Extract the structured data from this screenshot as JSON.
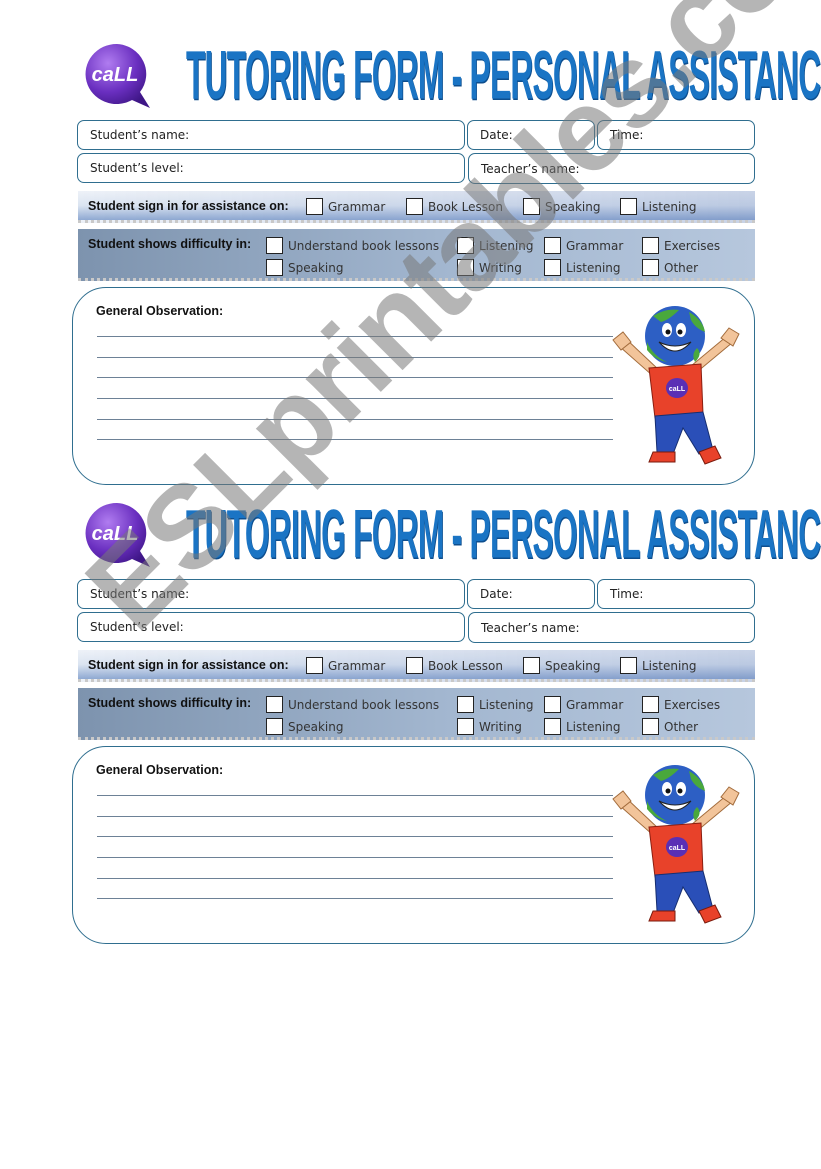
{
  "title": "TUTORING FORM - PERSONAL ASSISTANCE FILE",
  "logo_text": "caLL",
  "watermark": "ESLprintables.com",
  "colors": {
    "title": "#1a74c4",
    "logo": "#6a2fc0",
    "border": "#2f6e8f"
  },
  "forms": [
    {
      "fields": {
        "student_name": "Student’s name:",
        "date": "Date:",
        "time": "Time:",
        "student_level": "Student’s level:",
        "teacher_name": "Teacher’s name:"
      },
      "sign_in": {
        "label": "Student sign in for assistance on:",
        "options": [
          "Grammar",
          "Book Lesson",
          "Speaking",
          "Listening"
        ]
      },
      "difficulty": {
        "label": "Student shows difficulty in:",
        "options": [
          "Understand book lessons",
          "Listening",
          "Grammar",
          "Exercises",
          "Speaking",
          "Writing",
          "Listening",
          "Other"
        ]
      },
      "observation": {
        "label": "General Observation:",
        "line_count": 6
      }
    },
    {
      "fields": {
        "student_name": "Student’s name:",
        "date": "Date:",
        "time": "Time:",
        "student_level": "Student’s level:",
        "teacher_name": "Teacher’s name:"
      },
      "sign_in": {
        "label": "Student sign in for assistance on:",
        "options": [
          "Grammar",
          "Book Lesson",
          "Speaking",
          "Listening"
        ]
      },
      "difficulty": {
        "label": "Student shows difficulty in:",
        "options": [
          "Understand book lessons",
          "Listening",
          "Grammar",
          "Exercises",
          "Speaking",
          "Writing",
          "Listening",
          "Other"
        ]
      },
      "observation": {
        "label": "General Observation:",
        "line_count": 6
      }
    }
  ]
}
